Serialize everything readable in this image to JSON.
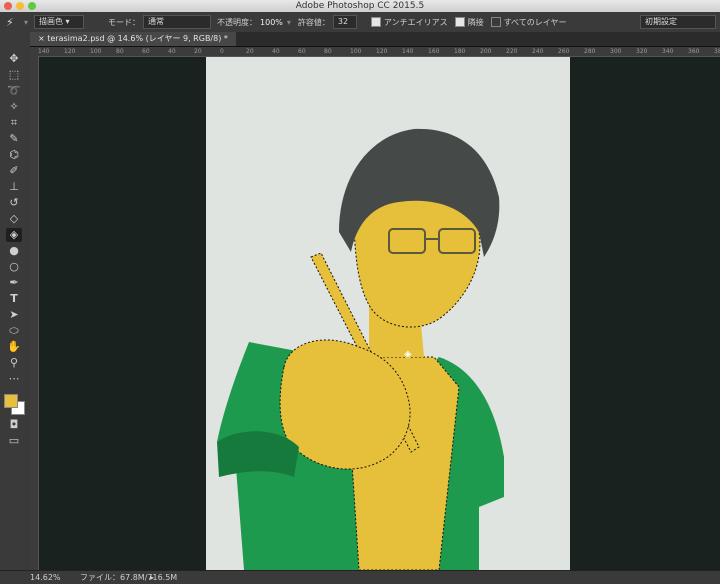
{
  "window": {
    "title": "Adobe Photoshop CC 2015.5"
  },
  "options_bar": {
    "fill_source": "描画色",
    "mode_label": "モード：",
    "mode_value": "通常",
    "opacity_label": "不透明度：",
    "opacity_value": "100%",
    "tolerance_label": "許容値：",
    "tolerance_value": "32",
    "antialias_label": "アンチエイリアス",
    "contiguous_label": "隣接",
    "all_layers_label": "すべてのレイヤー",
    "workspace": "初期設定"
  },
  "document_tab": {
    "label": "terasima2.psd @ 14.6% (レイヤー 9, RGB/8) *"
  },
  "ruler_top": {
    "labels": [
      "140",
      "120",
      "100",
      "80",
      "60",
      "40",
      "20",
      "0",
      "20",
      "40",
      "60",
      "80",
      "100",
      "120",
      "140",
      "160",
      "180",
      "200",
      "220",
      "240",
      "260",
      "280",
      "300",
      "320",
      "340",
      "360",
      "380"
    ]
  },
  "status_bar": {
    "zoom": "14.62%",
    "file_info": "ファイル：67.8M/716.5M"
  },
  "colors": {
    "foreground": "#e6c03a",
    "background": "#ffffff",
    "canvas_bg": "#e0e4e0",
    "shirt_green": "#1e9a4e",
    "skin_fill": "#e6c03a"
  },
  "tools": [
    "move-icon",
    "marquee-icon",
    "lasso-icon",
    "magic-wand-icon",
    "crop-icon",
    "eyedropper-icon",
    "healing-brush-icon",
    "brush-icon",
    "clone-stamp-icon",
    "history-brush-icon",
    "eraser-icon",
    "paint-bucket-icon",
    "blur-icon",
    "dodge-icon",
    "pen-icon",
    "type-icon",
    "path-select-icon",
    "ellipse-icon",
    "hand-icon",
    "zoom-icon",
    "more-icon"
  ]
}
